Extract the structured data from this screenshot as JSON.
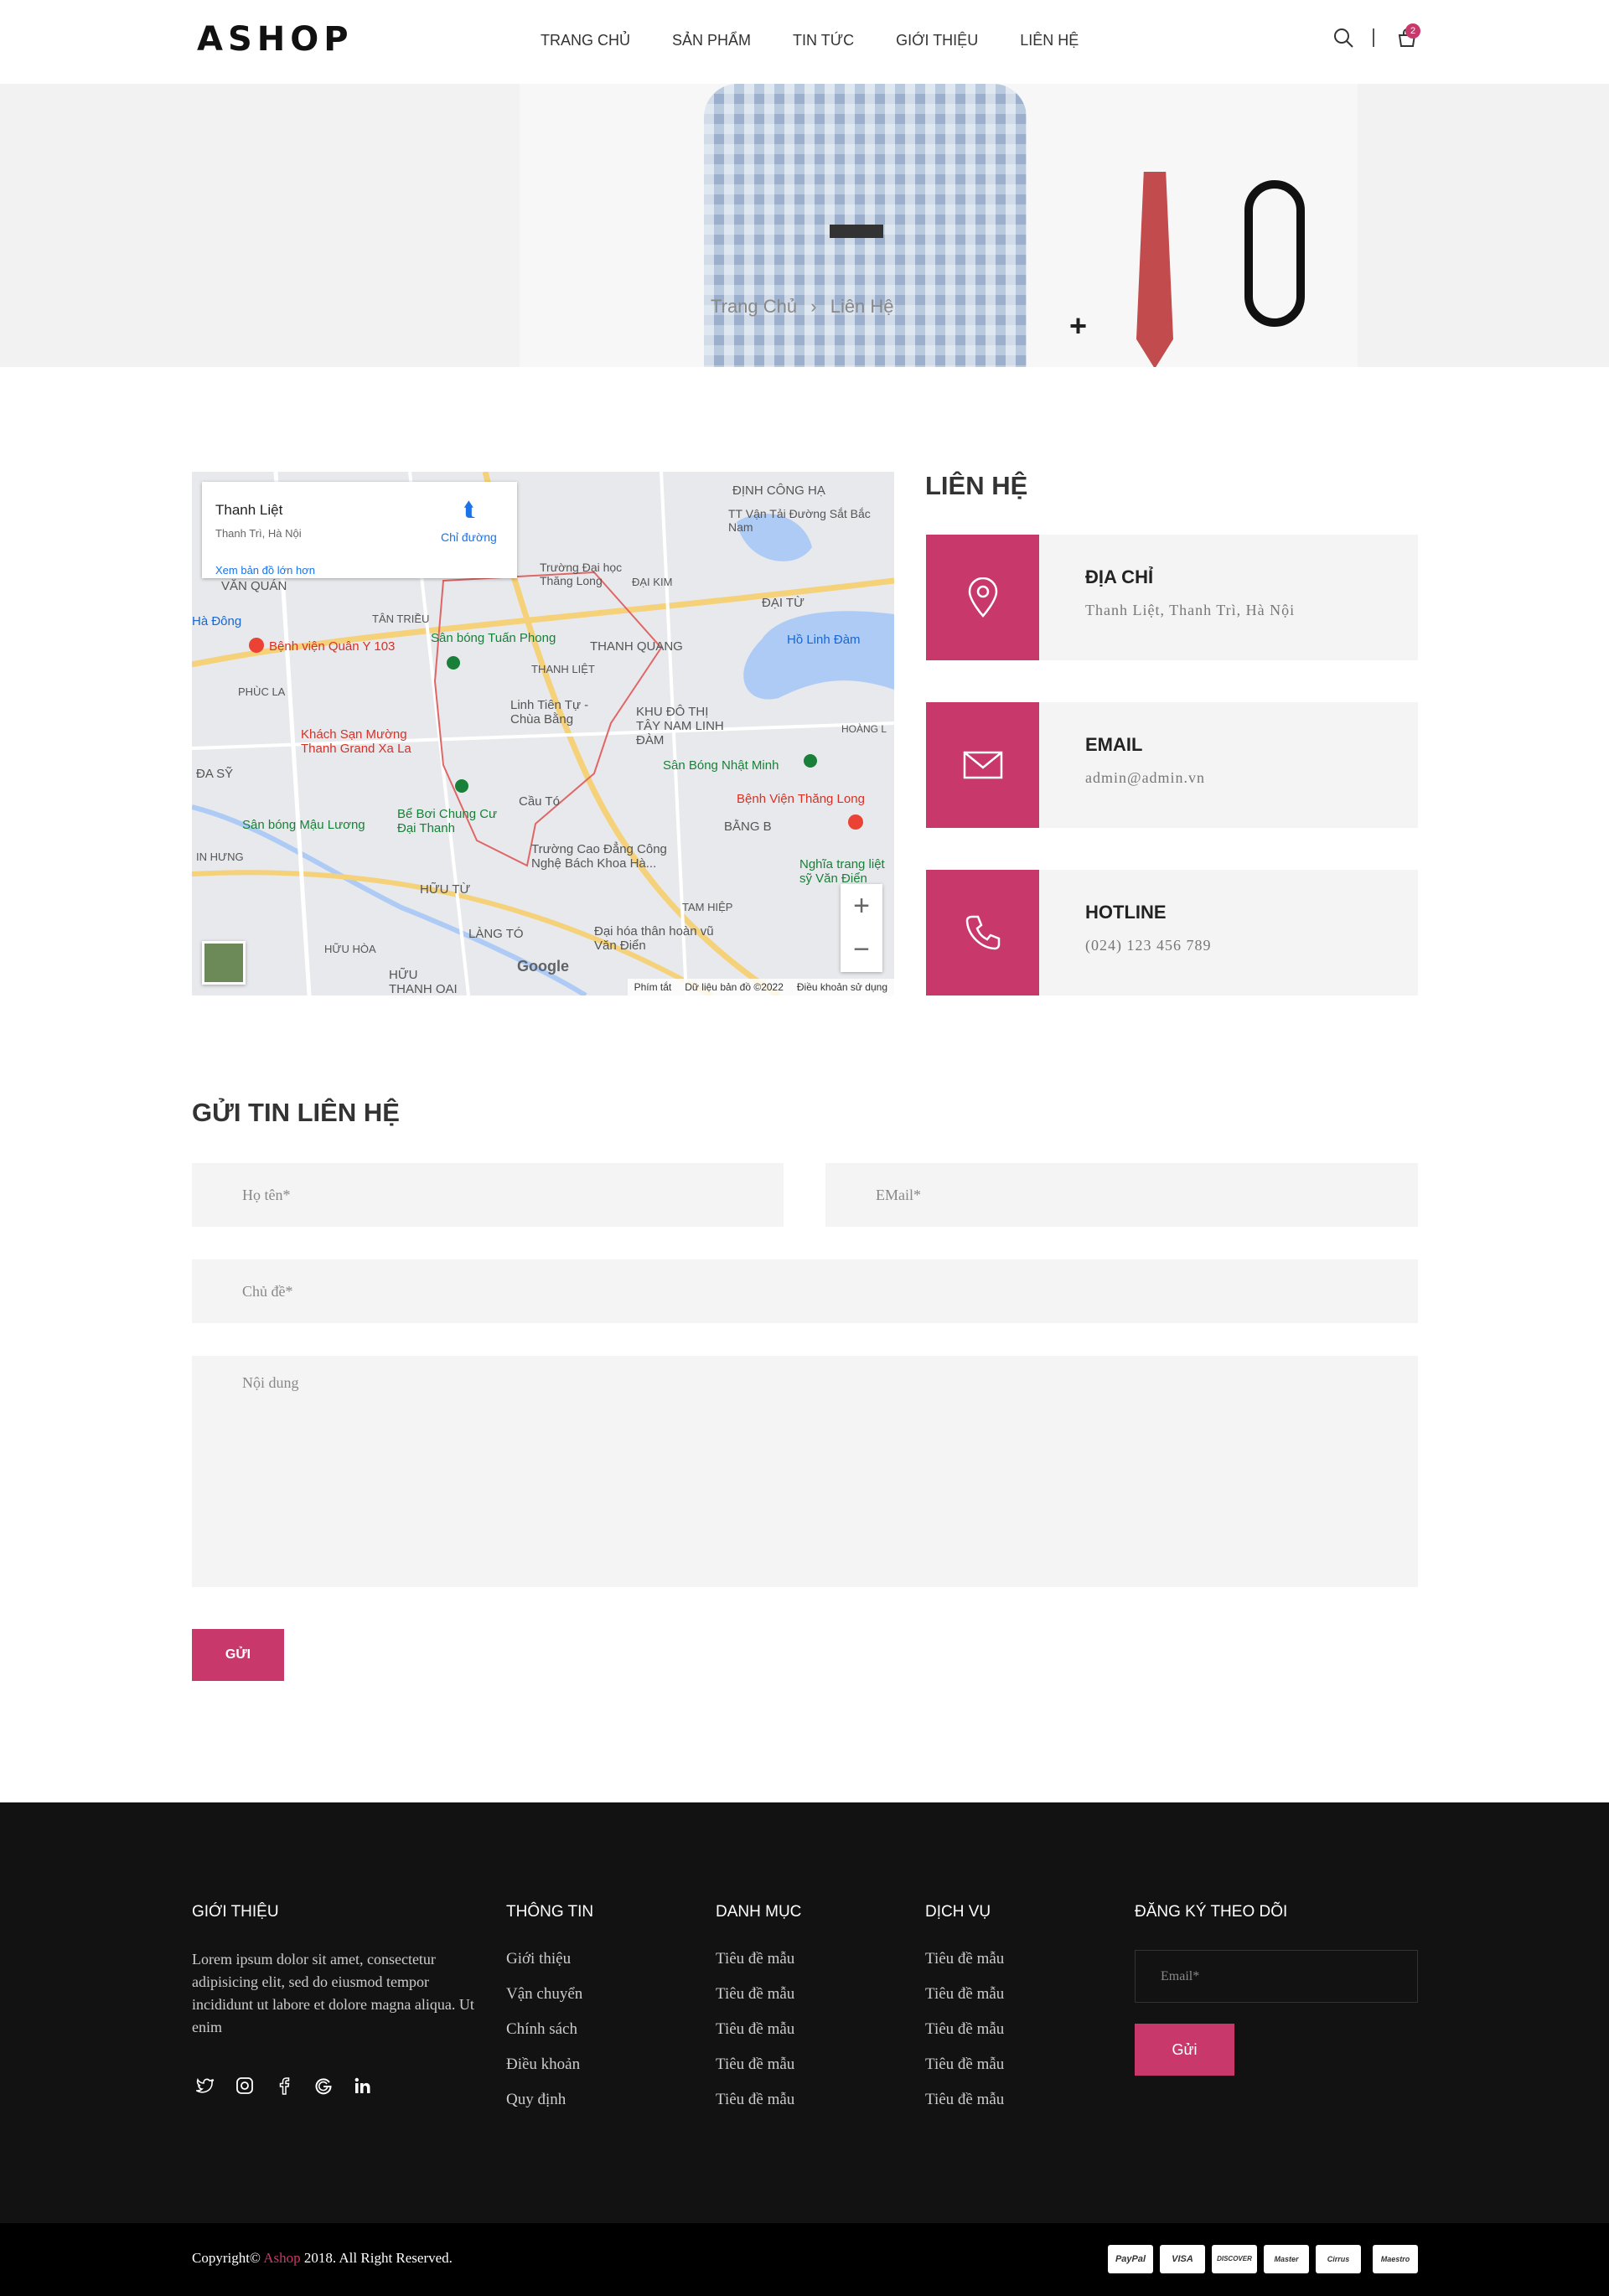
{
  "header": {
    "logo": "ASHOP",
    "nav": [
      "TRANG CHỦ",
      "SẢN PHẨM",
      "TIN TỨC",
      "GIỚI THIỆU",
      "LIÊN HỆ"
    ],
    "cart_count": "2"
  },
  "banner": {
    "breadcrumb_home": "Trang Chủ",
    "breadcrumb_sep": "›",
    "breadcrumb_current": "Liên Hệ",
    "plus": "+"
  },
  "map": {
    "place_name": "Thanh Liệt",
    "place_sub": "Thanh Trì, Hà Nội",
    "directions": "Chỉ đường",
    "larger_map": "Xem bản đồ lớn hơn",
    "labels": [
      "ĐỊNH CÔNG HẠ",
      "TT Vận Tải Đường Sắt Bắc Nam",
      "Trường Đại học Thăng Long",
      "ĐẠI KIM",
      "ĐẠI TỪ",
      "VĂN QUÁN",
      "TÂN TRIỀU",
      "Sân bóng Tuấn Phong",
      "THANH QUANG",
      "Bệnh viện Quân Y 103",
      "THANH LIỆT",
      "Hồ Linh Đàm",
      "PHÙC LA",
      "Linh Tiên Tự - Chùa Bằng",
      "KHU ĐÔ THỊ TÂY NAM LINH ĐÀM",
      "Khách Sạn Mường Thanh Grand Xa La",
      "Sân Bóng Nhật Minh",
      "ĐA SỸ",
      "Cầu Tó",
      "Bệnh Viện Thăng Long",
      "Sân bóng Mậu Lương",
      "Bể Bơi Chung Cư Đại Thanh",
      "BẰNG B",
      "Trường Cao Đẳng Công Nghệ Bách Khoa Hà...",
      "Nghĩa trang liệt sỹ Văn Điển",
      "HỮU TỪ",
      "TAM HIỆP",
      "LÀNG TÓ",
      "Đại hóa thân hoàn vũ Văn Điển",
      "HỮU HÒA",
      "HỮU THANH OAI",
      "Hà Đông",
      "HOÀNG L",
      "IN HƯNG"
    ],
    "google": "Google",
    "footer": [
      "Phím tắt",
      "Dữ liệu bản đồ ©2022",
      "Điều khoản sử dụng"
    ],
    "zoom_in": "+",
    "zoom_out": "−"
  },
  "contact": {
    "title": "LIÊN HỆ",
    "items": [
      {
        "heading": "ĐỊA CHỈ",
        "value": "Thanh Liệt, Thanh Trì, Hà Nội",
        "icon": "location-pin-icon"
      },
      {
        "heading": "EMAIL",
        "value": "admin@admin.vn",
        "icon": "envelope-icon"
      },
      {
        "heading": "HOTLINE",
        "value": "(024) 123 456 789",
        "icon": "phone-icon"
      }
    ]
  },
  "form": {
    "title": "GỬI TIN LIÊN HỆ",
    "name_placeholder": "Họ tên*",
    "email_placeholder": "EMail*",
    "subject_placeholder": "Chủ đề*",
    "message_placeholder": "Nội dung",
    "submit": "GỬI"
  },
  "footer": {
    "about_title": "GIỚI THIỆU",
    "about_text": "Lorem ipsum dolor sit amet, consectetur adipisicing elit, sed do eiusmod tempor incididunt ut labore et dolore magna aliqua. Ut enim",
    "info_title": "THÔNG TIN",
    "info_links": [
      "Giới thiệu",
      "Vận chuyển",
      "Chính sách",
      "Điều khoản",
      "Quy định"
    ],
    "category_title": "DANH MỤC",
    "category_links": [
      "Tiêu đề mẫu",
      "Tiêu đề mẫu",
      "Tiêu đề mẫu",
      "Tiêu đề mẫu",
      "Tiêu đề mẫu"
    ],
    "service_title": "DỊCH VỤ",
    "service_links": [
      "Tiêu đề mẫu",
      "Tiêu đề mẫu",
      "Tiêu đề mẫu",
      "Tiêu đề mẫu",
      "Tiêu đề mẫu"
    ],
    "subscribe_title": "ĐĂNG KÝ THEO DÕI",
    "subscribe_placeholder": "Email*",
    "subscribe_button": "Gửi",
    "social": [
      "twitter-icon",
      "instagram-icon",
      "facebook-icon",
      "google-icon",
      "linkedin-icon"
    ]
  },
  "copyright": {
    "prefix": "Copyright© ",
    "brand": "Ashop",
    "suffix": " 2018. All Right Reserved.",
    "payments": [
      "PayPal",
      "VISA",
      "DISCOVER",
      "Master",
      "Cirrus",
      "Maestro"
    ]
  },
  "colors": {
    "accent": "#c9386a",
    "footer_bg": "#121212",
    "light_bg": "#f4f4f4"
  }
}
